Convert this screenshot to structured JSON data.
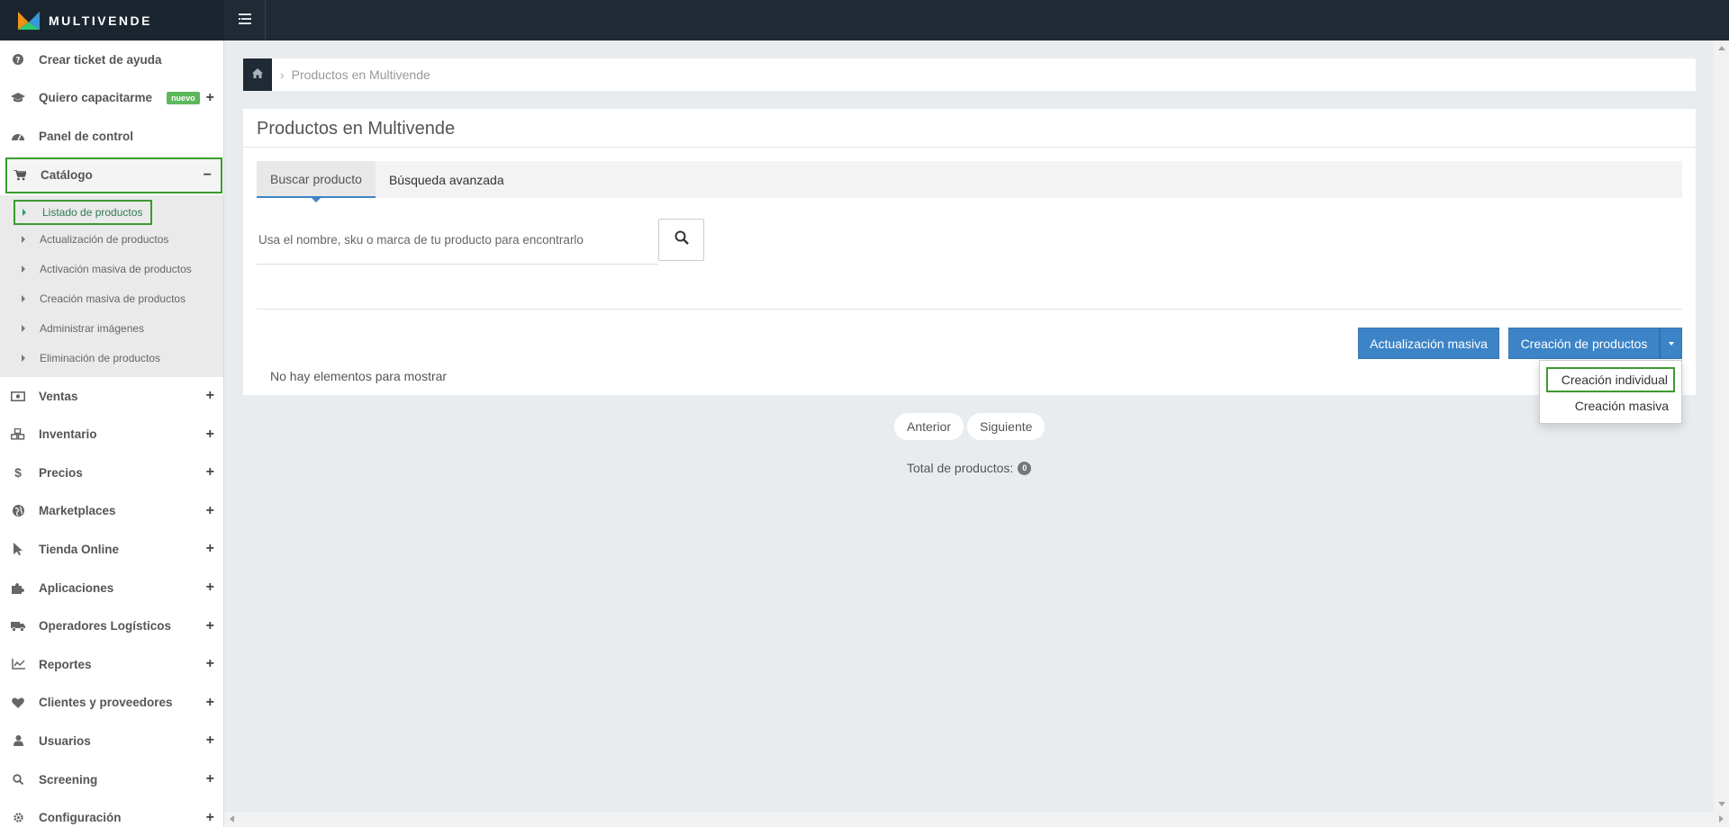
{
  "app": {
    "brand": "MULTIVENDE"
  },
  "colors": {
    "accent": "#3c84c7",
    "highlight": "#3a9b2f",
    "topbar": "#1f2a35",
    "badge_new": "#5cb85c"
  },
  "sidebar": {
    "items": [
      {
        "label": "Crear ticket de ayuda",
        "icon": "question-circle-icon"
      },
      {
        "label": "Quiero capacitarme",
        "icon": "graduation-cap-icon",
        "badge": "nuevo",
        "expand": "+"
      },
      {
        "label": "Panel de control",
        "icon": "dashboard-icon"
      },
      {
        "label": "Catálogo",
        "icon": "cart-icon",
        "expand": "−"
      },
      {
        "label": "Ventas",
        "icon": "money-icon",
        "expand": "+"
      },
      {
        "label": "Inventario",
        "icon": "cubes-icon",
        "expand": "+"
      },
      {
        "label": "Precios",
        "icon": "dollar-icon",
        "expand": "+"
      },
      {
        "label": "Marketplaces",
        "icon": "globe-icon",
        "expand": "+"
      },
      {
        "label": "Tienda Online",
        "icon": "pointer-icon",
        "expand": "+"
      },
      {
        "label": "Aplicaciones",
        "icon": "puzzle-icon",
        "expand": "+"
      },
      {
        "label": "Operadores Logísticos",
        "icon": "truck-icon",
        "expand": "+"
      },
      {
        "label": "Reportes",
        "icon": "line-chart-icon",
        "expand": "+"
      },
      {
        "label": "Clientes y proveedores",
        "icon": "heart-icon",
        "expand": "+"
      },
      {
        "label": "Usuarios",
        "icon": "user-icon",
        "expand": "+"
      },
      {
        "label": "Screening",
        "icon": "search-icon",
        "expand": "+"
      },
      {
        "label": "Configuración",
        "icon": "gear-icon",
        "expand": "+"
      }
    ],
    "catalog_sub": [
      "Listado de productos",
      "Actualización de productos",
      "Activación masiva de productos",
      "Creación masiva de productos",
      "Administrar imágenes",
      "Eliminación de productos"
    ]
  },
  "breadcrumb": {
    "current": "Productos en Multivende",
    "separator": "›"
  },
  "main": {
    "title": "Productos en Multivende",
    "tabs": [
      "Buscar producto",
      "Búsqueda avanzada"
    ],
    "search": {
      "placeholder": "Usa el nombre, sku o marca de tu producto para encontrarlo",
      "value": ""
    },
    "buttons": {
      "bulk_update": "Actualización masiva",
      "create": "Creación de productos"
    },
    "dropdown": [
      "Creación individual",
      "Creación masiva"
    ],
    "empty_text": "No hay elementos para mostrar",
    "pager": {
      "prev": "Anterior",
      "next": "Siguiente"
    },
    "total_label": "Total de productos:",
    "total_count": "0"
  }
}
